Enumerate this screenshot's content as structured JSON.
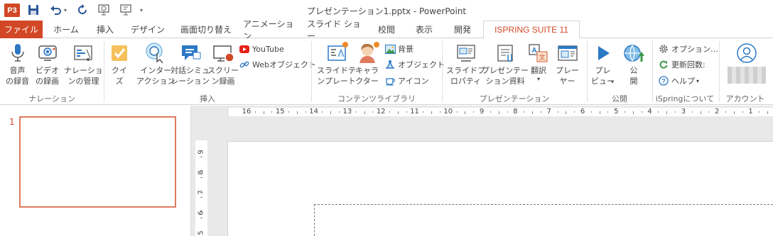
{
  "window": {
    "title": "プレゼンテーション1.pptx - PowerPoint",
    "logo_text": "P3"
  },
  "qat": {
    "undo_arrow": "▾",
    "more": "▾"
  },
  "tabs": [
    {
      "label": "ファイル"
    },
    {
      "label": "ホーム"
    },
    {
      "label": "挿入"
    },
    {
      "label": "デザイン"
    },
    {
      "label": "画面切り替え"
    },
    {
      "label": "アニメーション"
    },
    {
      "label": "スライド ショー"
    },
    {
      "label": "校閲"
    },
    {
      "label": "表示"
    },
    {
      "label": "開発"
    },
    {
      "label": "ISPRING SUITE 11"
    }
  ],
  "ribbon": {
    "narration": {
      "group": "ナレーション",
      "record_audio": "音声\nの録音",
      "record_video": "ビデオ\nの録画",
      "manage": "ナレーショ\nンの管理"
    },
    "insert": {
      "group": "挿入",
      "quiz": "クイ\nズ",
      "interaction": "インター\nアクション",
      "dialogue": "対話シミュ\nレーション",
      "screen_record": "スクリー\nン録画",
      "youtube": "YouTube",
      "web_object": "Webオブジェクト"
    },
    "content_library": {
      "group": "コンテンツライブラリ",
      "slide_templates": "スライドテ\nンプレート",
      "characters": "キャラ\nクター",
      "backgrounds": "背景",
      "objects": "オブジェクト",
      "icons": "アイコン"
    },
    "presentation": {
      "group": "プレゼンテーション",
      "slide_properties": "スライドプ\nロパティ",
      "resources": "プレゼンテー\nション資料",
      "translate": "翻訳",
      "translate_arrow": "▾",
      "player": "プレー\nヤー"
    },
    "publish": {
      "group": "公開",
      "preview": "プレ\nビュー",
      "preview_arrow": "▾",
      "publish": "公\n開"
    },
    "about": {
      "group": "iSpringについて",
      "options": "オプション…",
      "updates": "更新回数:",
      "help": "ヘルプ",
      "help_arrow": "▾"
    },
    "account": {
      "group": "アカウント"
    }
  },
  "slides": [
    {
      "number": "1"
    }
  ],
  "ruler": {
    "h_ticks": [
      "16",
      "15",
      "14",
      "13",
      "12",
      "11",
      "10",
      "9",
      "8",
      "7",
      "6",
      "5",
      "4",
      "3",
      "2",
      "1"
    ],
    "v_ticks": [
      "9",
      "8",
      "7",
      "6",
      "5"
    ]
  },
  "colors": {
    "accent": "#d24726",
    "thumb_border": "#e07a5f",
    "ribbon_blue": "#2b78c5"
  }
}
